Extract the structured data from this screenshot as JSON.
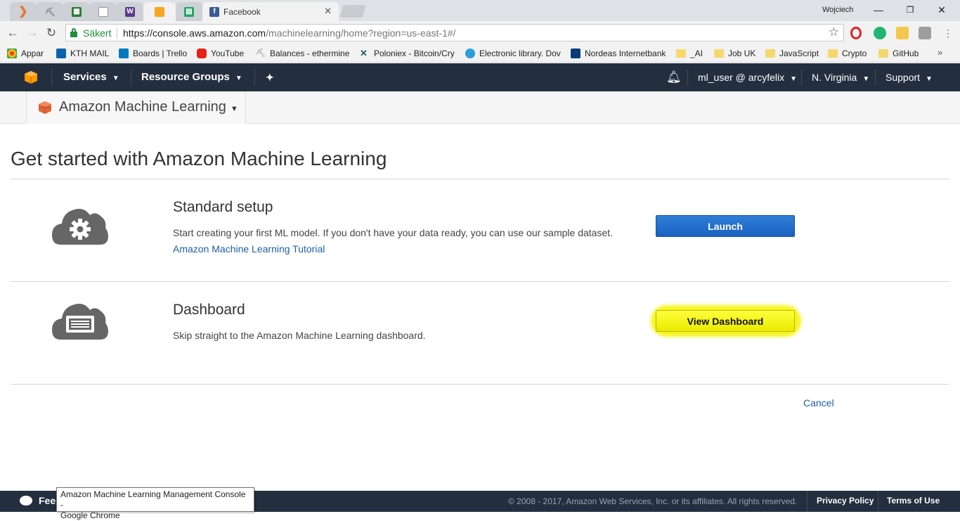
{
  "window": {
    "user": "Wojciech",
    "minimize_icon": "minimize-icon",
    "maximize_icon": "maximize-icon",
    "close_icon": "close-icon"
  },
  "tabs": [
    {
      "icon": "aws-tab-icon",
      "color": "#e8762d"
    },
    {
      "icon": "pickaxe-tab-icon",
      "color": "#888888"
    },
    {
      "icon": "spreadsheet-tab-icon",
      "color": "#2e7d32"
    },
    {
      "icon": "document-tab-icon",
      "color": "#999999"
    },
    {
      "icon": "w-tab-icon",
      "color": "#5b3a8c"
    },
    {
      "icon": "box-tab-icon",
      "color": "#f5a623"
    },
    {
      "icon": "sheets-tab-icon",
      "color": "#23a566"
    },
    {
      "icon": "facebook-icon",
      "color": "#3b5998",
      "title": "Facebook"
    }
  ],
  "address": {
    "secure_label": "Säkert",
    "url_host": "https://console.aws.amazon.com",
    "url_path": "/machinelearning/home?region=us-east-1#/"
  },
  "bookmarks": [
    {
      "label": "Appar",
      "icon": "apps-icon",
      "color": "#e94235"
    },
    {
      "label": "KTH MAIL",
      "icon": "outlook-icon",
      "color": "#0a64ad"
    },
    {
      "label": "Boards | Trello",
      "icon": "trello-icon",
      "color": "#0079bf"
    },
    {
      "label": "YouTube",
      "icon": "youtube-icon",
      "color": "#e62117"
    },
    {
      "label": "Balances - ethermine",
      "icon": "pickaxe-icon",
      "color": "#777777"
    },
    {
      "label": "Poloniex - Bitcoin/Cry",
      "icon": "poloniex-icon",
      "color": "#1b5e5e"
    },
    {
      "label": "Electronic library. Dov",
      "icon": "globe-icon",
      "color": "#2a9fd6"
    },
    {
      "label": "Nordeas Internetbank",
      "icon": "nordea-icon",
      "color": "#0a3a7a"
    },
    {
      "label": "_AI",
      "icon": "folder-icon",
      "color": "#f5d76e"
    },
    {
      "label": "Job UK",
      "icon": "folder-icon",
      "color": "#f5d76e"
    },
    {
      "label": "JavaScript",
      "icon": "folder-icon",
      "color": "#f5d76e"
    },
    {
      "label": "Crypto",
      "icon": "folder-icon",
      "color": "#f5d76e"
    },
    {
      "label": "GitHub",
      "icon": "folder-icon",
      "color": "#f5d76e"
    }
  ],
  "aws_nav": {
    "services": "Services",
    "resource_groups": "Resource Groups",
    "user": "ml_user @ arcyfelix",
    "region": "N. Virginia",
    "support": "Support"
  },
  "service": {
    "name": "Amazon Machine Learning"
  },
  "main": {
    "title": "Get started with Amazon Machine Learning",
    "standard": {
      "title": "Standard setup",
      "description": "Start creating your first ML model. If you don't have your data ready, you can use our sample dataset.",
      "link": "Amazon Machine Learning Tutorial",
      "button": "Launch"
    },
    "dashboard": {
      "title": "Dashboard",
      "description": "Skip straight to the Amazon Machine Learning dashboard.",
      "button": "View Dashboard"
    },
    "cancel": "Cancel"
  },
  "footer": {
    "feedback": "Fee",
    "copyright": "© 2008 - 2017, Amazon Web Services, Inc. or its affiliates. All rights reserved.",
    "privacy": "Privacy Policy",
    "terms": "Terms of Use"
  },
  "tooltip": {
    "line1": "Amazon Machine Learning Management Console -",
    "line2": "Google Chrome"
  },
  "colors": {
    "aws_nav_bg": "#232f3e",
    "launch_button": "#1a62c0",
    "highlight": "#f4f400",
    "link": "#1f5fa8"
  }
}
